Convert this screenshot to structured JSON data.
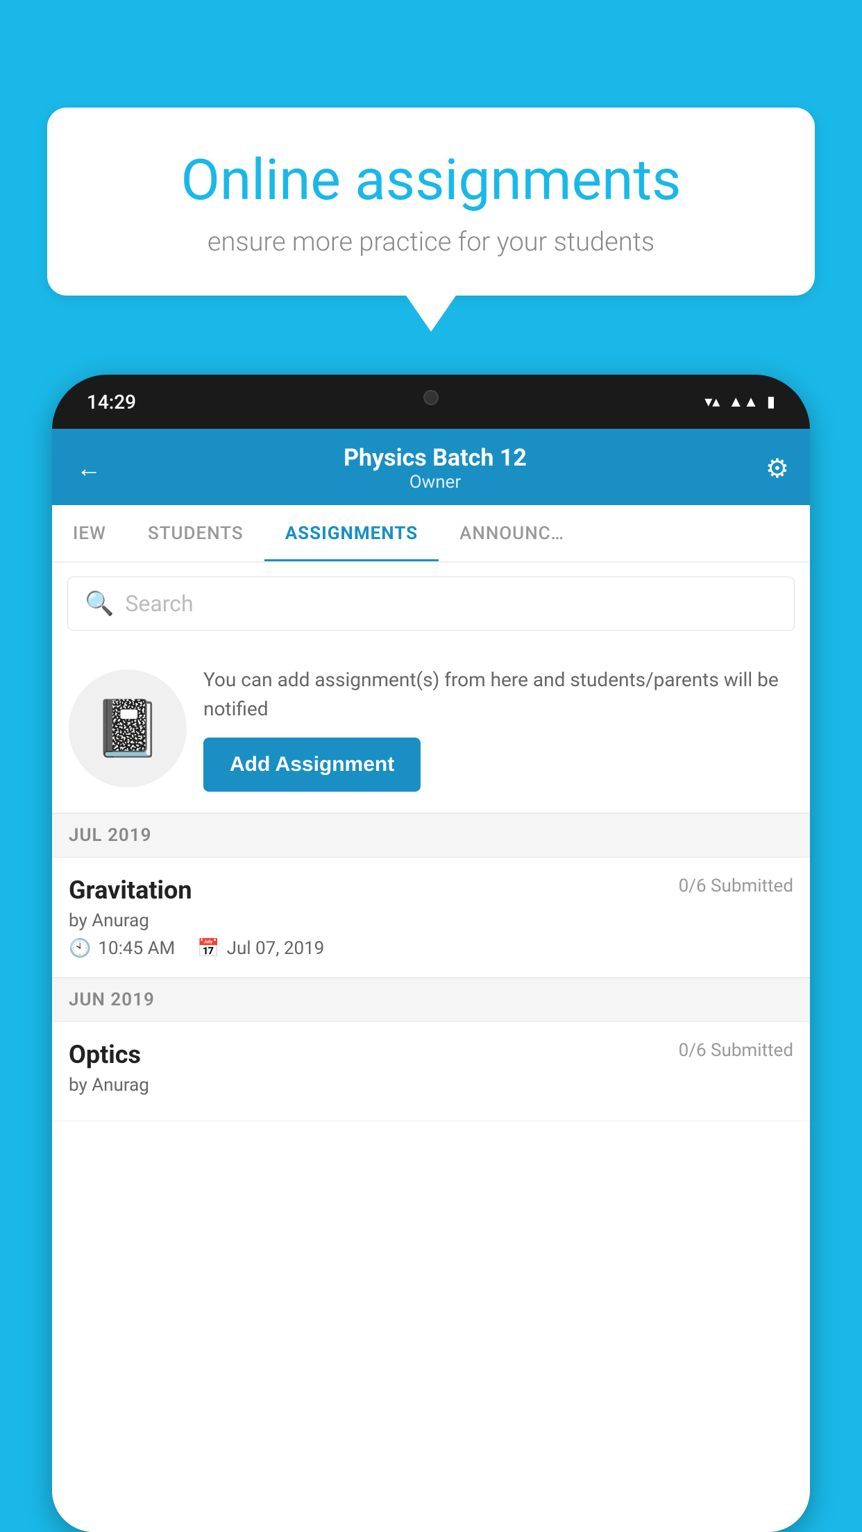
{
  "background": {
    "color": "#1ab8e8"
  },
  "speech_bubble": {
    "title": "Online assignments",
    "subtitle": "ensure more practice for your students"
  },
  "phone": {
    "status_bar": {
      "time": "14:29"
    },
    "header": {
      "title": "Physics Batch 12",
      "subtitle": "Owner",
      "back_label": "←",
      "settings_label": "⚙"
    },
    "tabs": [
      {
        "label": "IEW",
        "active": false
      },
      {
        "label": "STUDENTS",
        "active": false
      },
      {
        "label": "ASSIGNMENTS",
        "active": true
      },
      {
        "label": "ANNOUNCEMENTS",
        "active": false
      }
    ],
    "search": {
      "placeholder": "Search"
    },
    "promo": {
      "text": "You can add assignment(s) from here and students/parents will be notified",
      "button_label": "Add Assignment"
    },
    "sections": [
      {
        "month": "JUL 2019",
        "assignments": [
          {
            "title": "Gravitation",
            "submitted": "0/6 Submitted",
            "by": "by Anurag",
            "time": "10:45 AM",
            "date": "Jul 07, 2019"
          }
        ]
      },
      {
        "month": "JUN 2019",
        "assignments": [
          {
            "title": "Optics",
            "submitted": "0/6 Submitted",
            "by": "by Anurag",
            "time": "",
            "date": ""
          }
        ]
      }
    ]
  }
}
